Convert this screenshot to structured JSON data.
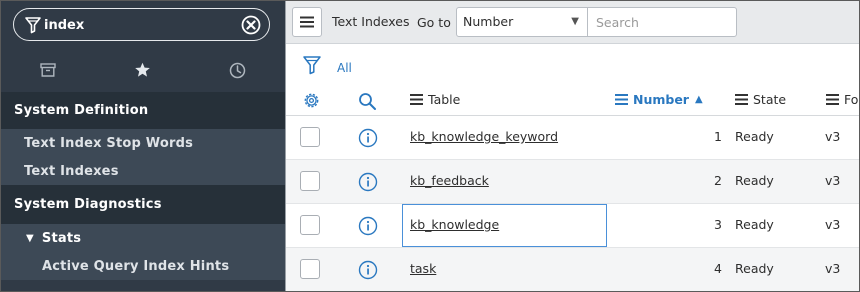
{
  "sidebar": {
    "filter": {
      "value": "index"
    },
    "tabs": [
      {
        "icon": "archive-icon"
      },
      {
        "icon": "star-icon"
      },
      {
        "icon": "clock-icon"
      }
    ],
    "sections": [
      {
        "label": "System Definition"
      },
      {
        "label": "System Diagnostics"
      }
    ],
    "items": [
      {
        "label": "Text Index Stop Words"
      },
      {
        "label": "Text Indexes"
      },
      {
        "label": "Stats"
      },
      {
        "label": "Active Query Index Hints"
      }
    ]
  },
  "toolbar": {
    "title": "Text Indexes",
    "goto_label": "Go to",
    "select_value": "Number",
    "search_placeholder": "Search"
  },
  "filter": {
    "all_label": "All"
  },
  "columns": [
    {
      "label": "Table"
    },
    {
      "label": "Number",
      "sorted": "asc"
    },
    {
      "label": "State"
    },
    {
      "label": "For"
    }
  ],
  "rows": [
    {
      "table": "kb_knowledge_keyword",
      "number": "1",
      "state": "Ready",
      "version": "v3"
    },
    {
      "table": "kb_feedback",
      "number": "2",
      "state": "Ready",
      "version": "v3"
    },
    {
      "table": "kb_knowledge",
      "number": "3",
      "state": "Ready",
      "version": "v3"
    },
    {
      "table": "task",
      "number": "4",
      "state": "Ready",
      "version": "v3"
    }
  ],
  "colors": {
    "sidebar_bg": "#303a46",
    "section_bg": "#263039",
    "item_bg": "#3d4956",
    "accent": "#2a78c0"
  }
}
